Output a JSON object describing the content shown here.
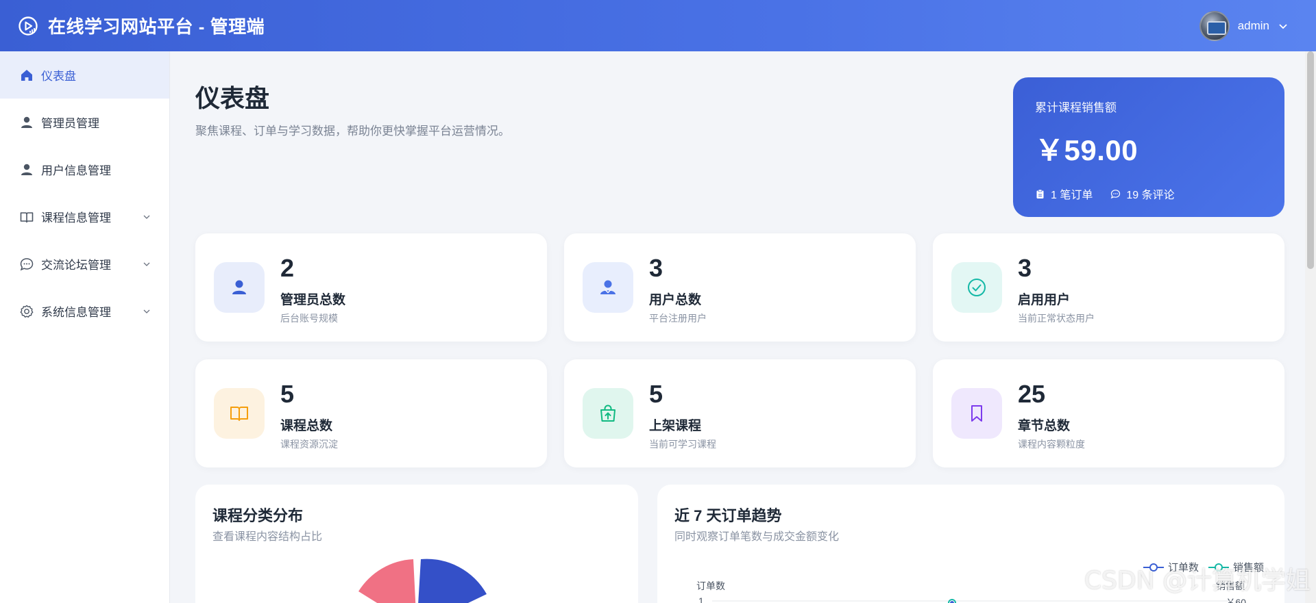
{
  "header": {
    "app_title": "在线学习网站平台 - 管理端",
    "user_name": "admin"
  },
  "sidebar": {
    "items": [
      {
        "label": "仪表盘",
        "icon": "home-icon",
        "active": true
      },
      {
        "label": "管理员管理",
        "icon": "user-icon"
      },
      {
        "label": "用户信息管理",
        "icon": "user-icon"
      },
      {
        "label": "课程信息管理",
        "icon": "book-icon",
        "expandable": true
      },
      {
        "label": "交流论坛管理",
        "icon": "chat-icon",
        "expandable": true
      },
      {
        "label": "系统信息管理",
        "icon": "gear-icon",
        "expandable": true
      }
    ]
  },
  "page": {
    "title": "仪表盘",
    "subtitle": "聚焦课程、订单与学习数据，帮助你更快掌握平台运营情况。"
  },
  "sales": {
    "label": "累计课程销售额",
    "value": "￥59.00",
    "orders": "1 笔订单",
    "comments": "19 条评论"
  },
  "stats": [
    {
      "value": "2",
      "title": "管理员总数",
      "desc": "后台账号规模",
      "icon": "user-icon",
      "color": "#3a5fd4",
      "bg": "#e8edfb"
    },
    {
      "value": "3",
      "title": "用户总数",
      "desc": "平台注册用户",
      "icon": "users-icon",
      "color": "#4a72e6",
      "bg": "#e8eefd"
    },
    {
      "value": "3",
      "title": "启用用户",
      "desc": "当前正常状态用户",
      "icon": "check-circle-icon",
      "color": "#14b8a6",
      "bg": "#e3f7f4"
    },
    {
      "value": "5",
      "title": "课程总数",
      "desc": "课程资源沉淀",
      "icon": "book-icon",
      "color": "#f59e0b",
      "bg": "#fdf2e0"
    },
    {
      "value": "5",
      "title": "上架课程",
      "desc": "当前可学习课程",
      "icon": "shopping-bag-icon",
      "color": "#10b981",
      "bg": "#e0f6ee"
    },
    {
      "value": "25",
      "title": "章节总数",
      "desc": "课程内容颗粒度",
      "icon": "bookmark-icon",
      "color": "#7c3aed",
      "bg": "#efe8fd"
    }
  ],
  "panels": {
    "category": {
      "title": "课程分类分布",
      "subtitle": "查看课程内容结构占比"
    },
    "trend": {
      "title": "近 7 天订单趋势",
      "subtitle": "同时观察订单笔数与成交金额变化",
      "legend": [
        "订单数",
        "销售额"
      ],
      "y_left_label": "订单数",
      "y_right_label": "销售额",
      "y_left_tick": "1",
      "y_right_tick": "￥60"
    }
  },
  "watermark": "CSDN @计算机学姐"
}
